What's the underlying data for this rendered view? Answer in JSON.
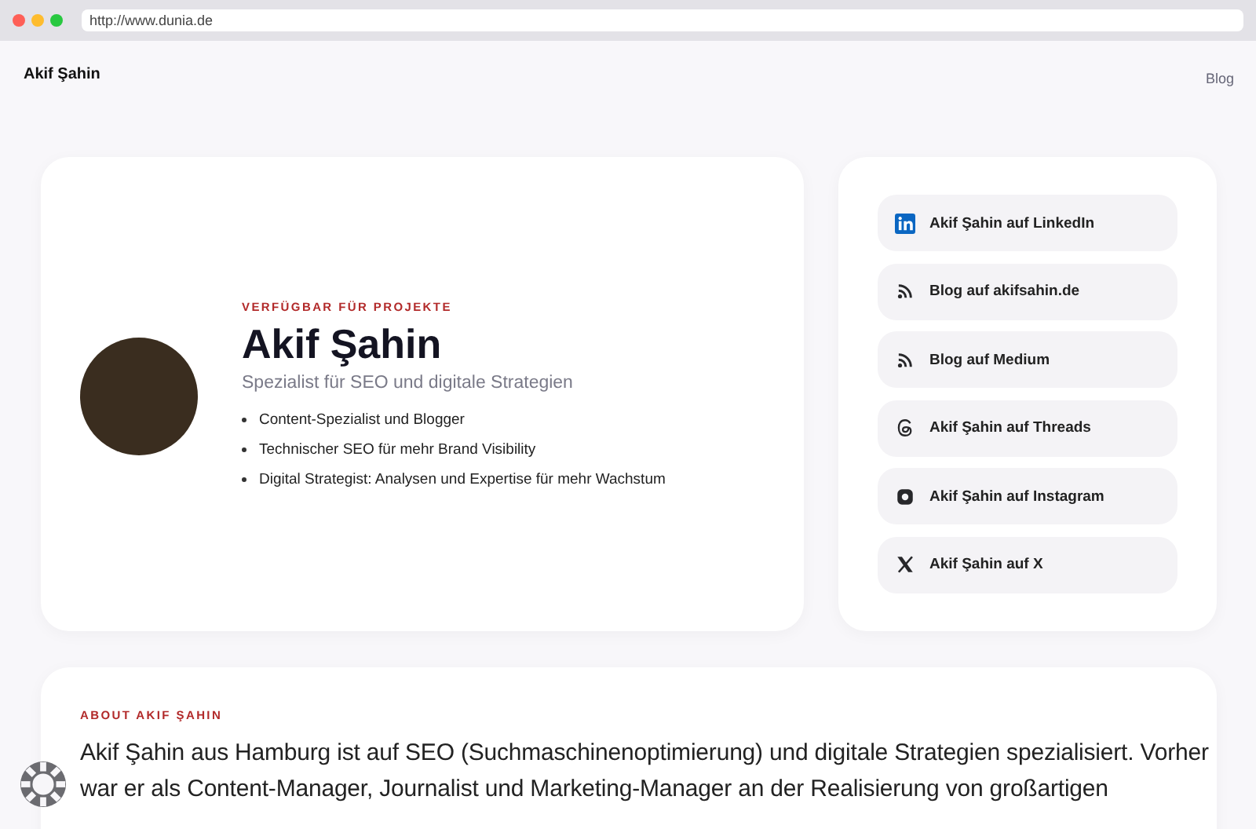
{
  "browser": {
    "url": "http://www.dunia.de"
  },
  "header": {
    "site_title": "Akif Şahin",
    "nav": [
      "Blog"
    ]
  },
  "profile": {
    "eyebrow": "VERFÜGBAR FÜR PROJEKTE",
    "name": "Akif Şahin",
    "subtitle": "Spezialist für SEO und digitale Strategien",
    "highlights": [
      "Content-Spezialist und Blogger",
      "Technischer SEO für mehr Brand Visibility",
      "Digital Strategist: Analysen und Expertise für mehr Wachstum"
    ]
  },
  "links": [
    {
      "kind": "linkedin",
      "label": "Akif Şahin auf LinkedIn"
    },
    {
      "kind": "rss",
      "label": "Blog auf akifsahin.de"
    },
    {
      "kind": "rss",
      "label": "Blog auf Medium"
    },
    {
      "kind": "threads",
      "label": "Akif Şahin auf Threads"
    },
    {
      "kind": "instagram",
      "label": "Akif Şahin auf Instagram"
    },
    {
      "kind": "x",
      "label": "Akif Şahin auf X"
    }
  ],
  "about": {
    "eyebrow": "ABOUT AKIF ŞAHIN",
    "text": "Akif Şahin aus Hamburg ist auf SEO (Suchmaschinenoptimierung) und digitale Strategien spezialisiert. Vorher war er als Content-Manager, Journalist und Marketing-Manager an der Realisierung von großartigen"
  }
}
